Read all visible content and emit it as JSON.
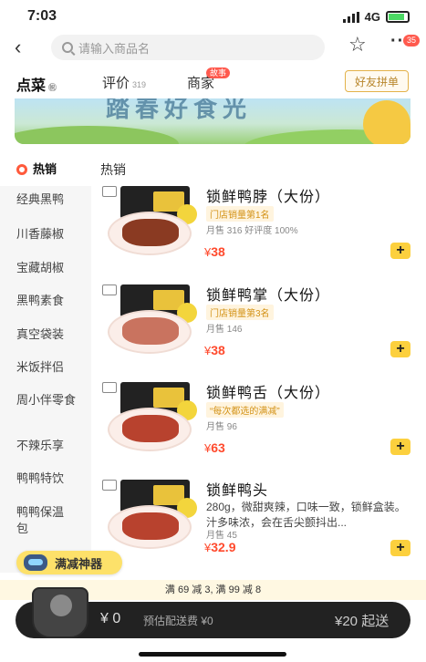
{
  "status": {
    "time": "7:03",
    "network": "4G"
  },
  "topnav": {
    "search_placeholder": "请输入商品名",
    "more_badge": "35"
  },
  "tabs": [
    {
      "label": "点菜",
      "sup": "㊗"
    },
    {
      "label": "评价",
      "sup": "319"
    },
    {
      "label": "商家",
      "badge": "故事"
    }
  ],
  "friend_button": "好友拼单",
  "banner": {
    "text": "踏春好食光"
  },
  "sidebar": {
    "items": [
      "热销",
      "经典黑鸭",
      "川香藤椒",
      "宝藏胡椒",
      "黑鸭素食",
      "真空袋装",
      "米饭拌侣",
      "周小伴零食",
      "不辣乐享",
      "鸭鸭特饮",
      "鸭鸭保温包"
    ]
  },
  "section_title": "热销",
  "products": [
    {
      "name": "锁鲜鸭脖（大份）",
      "tag": "门店销量第1名",
      "sales": "月售 316  好评度 100%",
      "currency": "¥",
      "price": "38"
    },
    {
      "name": "锁鲜鸭掌（大份）",
      "tag": "门店销量第3名",
      "sales": "月售 146",
      "currency": "¥",
      "price": "38"
    },
    {
      "name": "锁鲜鸭舌（大份）",
      "tag": "“每次都选的满减”",
      "sales": "月售 96",
      "currency": "¥",
      "price": "63"
    },
    {
      "name": "锁鲜鸭头",
      "desc": "280g，微甜爽辣，口味一致，锁鲜盒装。汁多味浓，会在舌尖颤抖出...",
      "sales": "月售 45",
      "currency": "¥",
      "price": "32.9"
    }
  ],
  "promo_float": "满减神器",
  "discount_bar": "满 69 减 3, 满 99 减 8",
  "cart": {
    "total": "¥ 0",
    "fee": "预估配送费 ¥0",
    "min_order": "¥20 起送"
  },
  "colors": {
    "accent_yellow": "#fcd03e",
    "price_red": "#ff4a2d",
    "badge_red": "#ff5a4e"
  }
}
